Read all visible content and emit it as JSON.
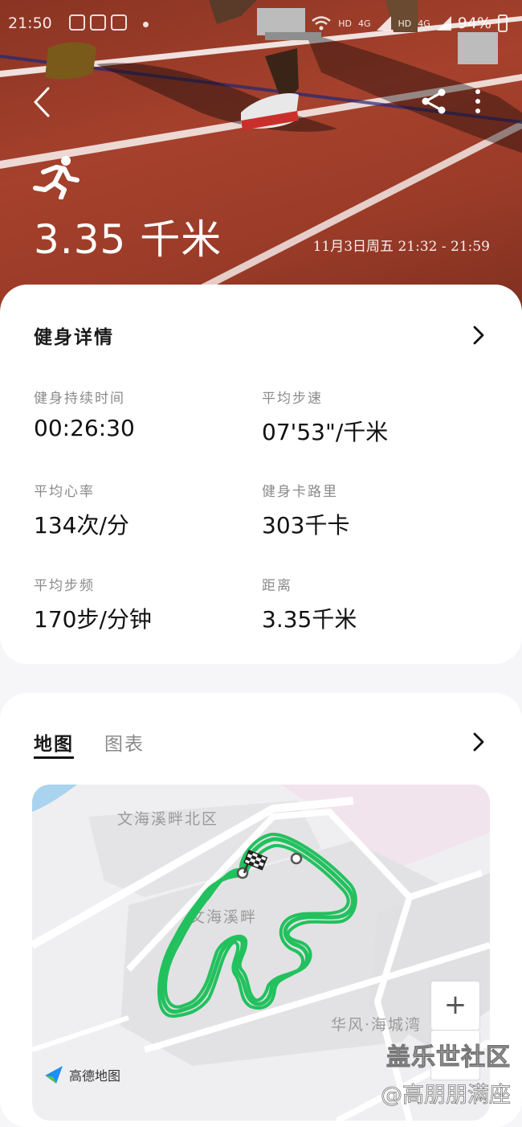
{
  "status_bar": {
    "time": "21:50",
    "network_1": "HD",
    "network_2": "4G",
    "network_3": "HD",
    "network_4": "4G",
    "battery": "94%"
  },
  "hero": {
    "distance": "3.35 千米",
    "date_time": "11月3日周五 21:32 - 21:59"
  },
  "details": {
    "title": "健身详情",
    "stats": [
      {
        "label": "健身持续时间",
        "value": "00:26:30"
      },
      {
        "label": "平均步速",
        "value": "07'53\"/千米"
      },
      {
        "label": "平均心率",
        "value": "134次/分"
      },
      {
        "label": "健身卡路里",
        "value": "303千卡"
      },
      {
        "label": "平均步频",
        "value": "170步/分钟"
      },
      {
        "label": "距离",
        "value": "3.35千米"
      }
    ]
  },
  "map_section": {
    "tab_map": "地图",
    "tab_chart": "图表",
    "labels": {
      "north": "文海溪畔北区",
      "center": "文海溪畔",
      "south": "华风·海城湾"
    },
    "zoom_in": "+",
    "provider": "高德地图"
  },
  "watermark": {
    "line1": "盖乐世社区",
    "line2": "@高朋朋满座"
  },
  "colors": {
    "track_red": "#a5412c",
    "route_green": "#22c15e",
    "card_bg": "#ffffff"
  }
}
